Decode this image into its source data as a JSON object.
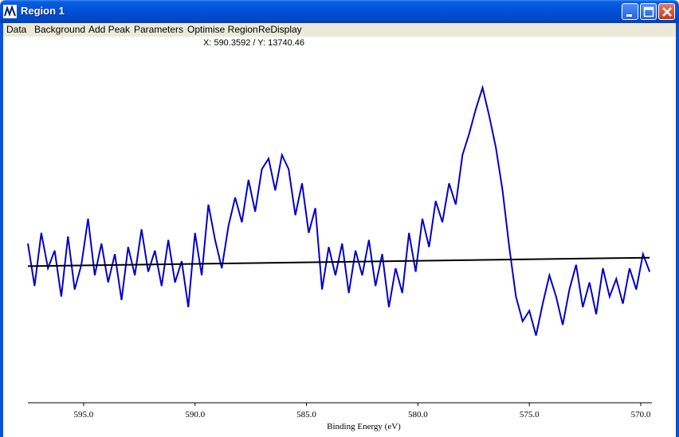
{
  "window": {
    "title": "Region 1",
    "controls": [
      "minimize",
      "maximize",
      "close"
    ]
  },
  "menu": {
    "items": [
      {
        "label": "Data"
      },
      {
        "label": "Background"
      },
      {
        "label": "Add Peak"
      },
      {
        "label": "Parameters"
      },
      {
        "label": "Optimise Region"
      },
      {
        "label": "ReDisplay"
      }
    ]
  },
  "cursor_readout": "X: 590.3592 / Y: 13740.46",
  "colors": {
    "title_bar": "#0052d8",
    "menu_bar": "#ece9d8",
    "spectrum": "#0000c8",
    "background_line": "#000000"
  },
  "chart_data": {
    "type": "line",
    "xlabel": "Binding Energy (eV)",
    "x_reversed": true,
    "xlim": [
      597.5,
      569.5
    ],
    "ylim": [
      10800,
      15500
    ],
    "x_ticks": [
      595.0,
      590.0,
      585.0,
      580.0,
      575.0,
      570.0
    ],
    "x_tick_labels": [
      "595.0",
      "590.0",
      "585.0",
      "580.0",
      "575.0",
      "570.0"
    ],
    "grid": false,
    "series": [
      {
        "role": "spectrum",
        "x": [
          597.5,
          597.2,
          596.9,
          596.6,
          596.3,
          596.0,
          595.7,
          595.4,
          595.1,
          594.8,
          594.5,
          594.2,
          593.9,
          593.6,
          593.3,
          593.0,
          592.7,
          592.4,
          592.1,
          591.8,
          591.5,
          591.2,
          590.9,
          590.6,
          590.3,
          590.0,
          589.7,
          589.4,
          589.1,
          588.8,
          588.5,
          588.2,
          587.9,
          587.6,
          587.3,
          587.0,
          586.7,
          586.4,
          586.1,
          585.8,
          585.5,
          585.2,
          584.9,
          584.6,
          584.3,
          584.0,
          583.7,
          583.4,
          583.1,
          582.8,
          582.5,
          582.2,
          581.9,
          581.6,
          581.3,
          581.0,
          580.7,
          580.4,
          580.1,
          579.8,
          579.5,
          579.2,
          578.9,
          578.6,
          578.3,
          578.0,
          577.7,
          577.4,
          577.1,
          576.8,
          576.5,
          576.2,
          575.9,
          575.6,
          575.3,
          575.0,
          574.7,
          574.4,
          574.1,
          573.8,
          573.5,
          573.2,
          572.9,
          572.6,
          572.3,
          572.0,
          571.7,
          571.4,
          571.1,
          570.8,
          570.5,
          570.2,
          569.9,
          569.6
        ],
        "y": [
          13050,
          12450,
          13200,
          12700,
          12950,
          12300,
          13150,
          12400,
          12750,
          13400,
          12600,
          13050,
          12500,
          12900,
          12250,
          13000,
          12600,
          13250,
          12650,
          12950,
          12450,
          13100,
          12500,
          12800,
          12150,
          13200,
          12600,
          13600,
          13100,
          12700,
          13300,
          13700,
          13350,
          13950,
          13500,
          14100,
          14250,
          13800,
          14300,
          14100,
          13450,
          13900,
          13200,
          13550,
          12400,
          13000,
          12600,
          13050,
          12350,
          12950,
          12600,
          13100,
          12450,
          12900,
          12150,
          12700,
          12350,
          13200,
          12650,
          13400,
          13000,
          13650,
          13350,
          13900,
          13600,
          14300,
          14600,
          14950,
          15250,
          14850,
          14400,
          13800,
          13000,
          12300,
          11950,
          12100,
          11750,
          12200,
          12600,
          12300,
          11900,
          12400,
          12750,
          12150,
          12500,
          12050,
          12700,
          12300,
          12550,
          12200,
          12700,
          12400,
          12900,
          12650
        ]
      },
      {
        "role": "background",
        "x": [
          597.5,
          569.6
        ],
        "y": [
          12730,
          12850
        ]
      }
    ]
  }
}
